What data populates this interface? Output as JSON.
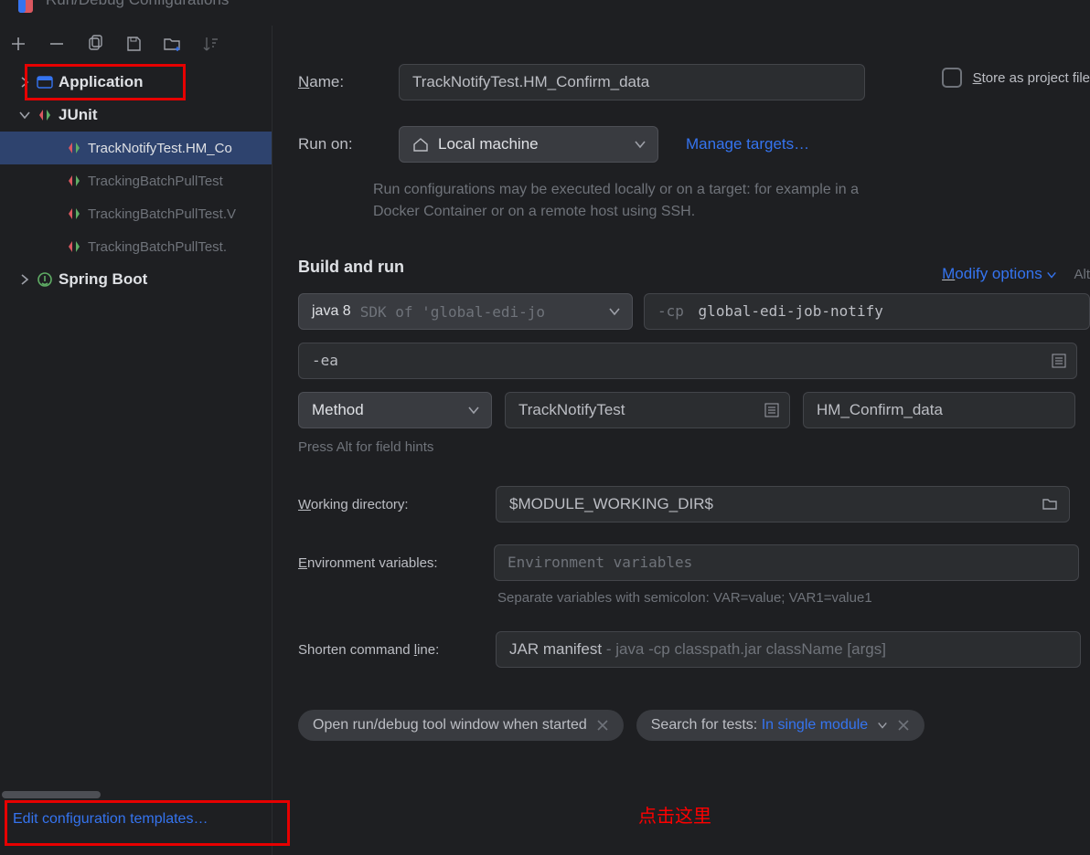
{
  "titlebar": {
    "title": "Run/Debug Configurations"
  },
  "toolbar": {},
  "tree": {
    "application": "Application",
    "junit": "JUnit",
    "items": [
      "TrackNotifyTest.HM_Co",
      "TrackingBatchPullTest",
      "TrackingBatchPullTest.V",
      "TrackingBatchPullTest."
    ],
    "springboot": "Spring Boot"
  },
  "sidebar": {
    "edit_templates": "Edit configuration templates…"
  },
  "form": {
    "name_label": "Name:",
    "name_value": "TrackNotifyTest.HM_Confirm_data",
    "store_label": "Store as project file",
    "runon_label": "Run on:",
    "runon_value": "Local machine",
    "manage_targets": "Manage targets…",
    "runon_hint": "Run configurations may be executed locally or on a target: for example in a Docker Container or on a remote host using SSH.",
    "build_run": "Build and run",
    "modify_options": "Modify options",
    "alt_hint": "Alt",
    "java_prefix": "java 8",
    "java_hint": "SDK of 'global-edi-jo",
    "cp_prefix": "-cp",
    "cp_value": "global-edi-job-notify",
    "vmopts": "-ea",
    "method": "Method",
    "class_value": "TrackNotifyTest",
    "test_value": "HM_Confirm_data",
    "press_hint": "Press Alt for field hints",
    "wd_label": "Working directory:",
    "wd_value": "$MODULE_WORKING_DIR$",
    "env_label": "Environment variables:",
    "env_placeholder": "Environment variables",
    "sep_hint": "Separate variables with semicolon: VAR=value; VAR1=value1",
    "shorten_label": "Shorten command line:",
    "shorten_value": "JAR manifest",
    "shorten_hint": " - java -cp classpath.jar className [args]",
    "chip1": "Open run/debug tool window when started",
    "chip2_a": "Search for tests: ",
    "chip2_b": "In single module"
  },
  "annotation": "点击这里"
}
